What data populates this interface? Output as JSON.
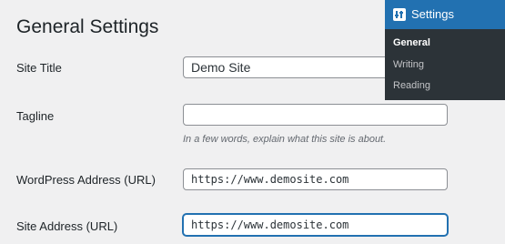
{
  "page": {
    "title": "General Settings"
  },
  "form": {
    "site_title": {
      "label": "Site Title",
      "value": "Demo Site"
    },
    "tagline": {
      "label": "Tagline",
      "value": "",
      "description": "In a few words, explain what this site is about."
    },
    "wordpress_address": {
      "label": "WordPress Address (URL)",
      "value": "https://www.demosite.com"
    },
    "site_address": {
      "label": "Site Address (URL)",
      "value": "https://www.demosite.com"
    }
  },
  "menu": {
    "head": {
      "label": "Settings",
      "icon": "settings-icon"
    },
    "items": [
      {
        "label": "General",
        "current": true
      },
      {
        "label": "Writing",
        "current": false
      },
      {
        "label": "Reading",
        "current": false
      }
    ]
  },
  "colors": {
    "accent": "#2271b1",
    "menu_bg": "#2c3338",
    "page_bg": "#f0f0f1"
  }
}
